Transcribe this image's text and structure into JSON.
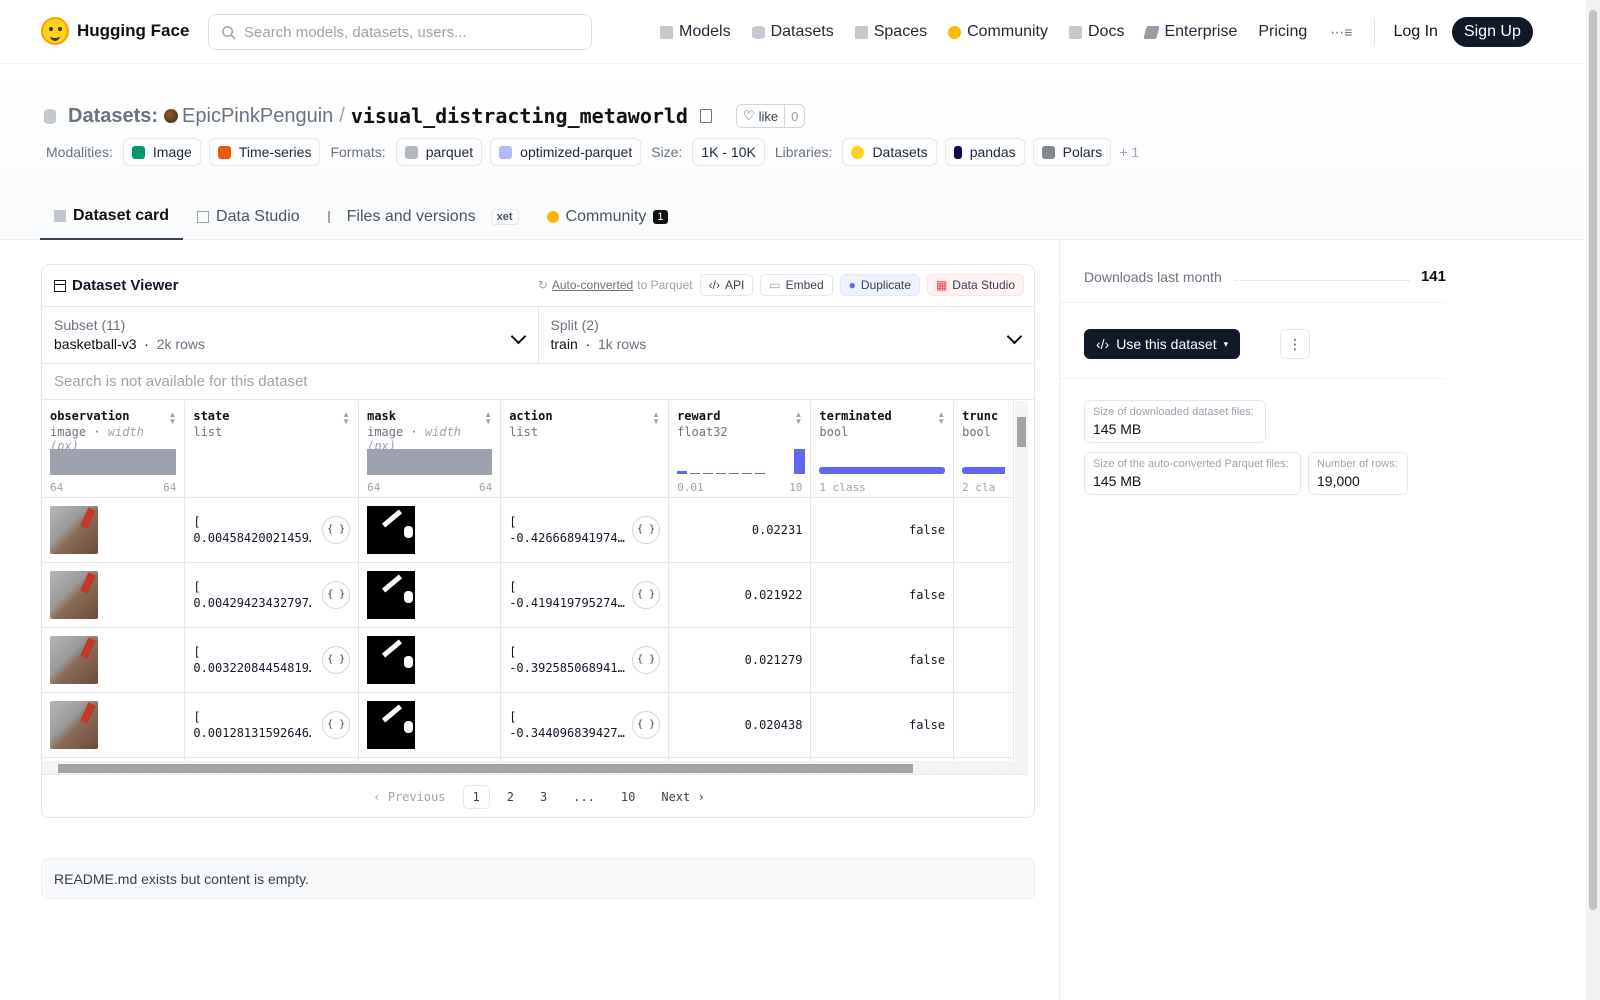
{
  "nav": {
    "brand": "Hugging Face",
    "search_placeholder": "Search models, datasets, users...",
    "links": [
      {
        "label": "Models",
        "icon": "models-icon",
        "color": "#9ca3af"
      },
      {
        "label": "Datasets",
        "icon": "datasets-icon",
        "color": "#9ca3af"
      },
      {
        "label": "Spaces",
        "icon": "spaces-icon",
        "color": "#9ca3af"
      },
      {
        "label": "Community",
        "icon": "community-icon",
        "color": "#ffb800"
      },
      {
        "label": "Docs",
        "icon": "docs-icon",
        "color": "#9ca3af"
      },
      {
        "label": "Enterprise",
        "icon": "enterprise-icon",
        "color": "#6b7280"
      },
      {
        "label": "Pricing",
        "icon": "",
        "color": ""
      }
    ],
    "login": "Log In",
    "signup": "Sign Up"
  },
  "header": {
    "section": "Datasets:",
    "owner": "EpicPinkPenguin",
    "separator": "/",
    "repo": "visual_distracting_metaworld",
    "like_label": "like",
    "like_count": "0",
    "modalities_label": "Modalities:",
    "modalities": [
      {
        "label": "Image",
        "color": "#059669"
      },
      {
        "label": "Time-series",
        "color": "#ea580c"
      }
    ],
    "formats_label": "Formats:",
    "formats": [
      {
        "label": "parquet",
        "color": "#6b7280"
      },
      {
        "label": "optimized-parquet",
        "color": "#818cf8"
      }
    ],
    "size_label": "Size:",
    "size": "1K - 10K",
    "libraries_label": "Libraries:",
    "libraries": [
      {
        "label": "Datasets",
        "color": "#ffd21e"
      },
      {
        "label": "pandas",
        "color": "#130754"
      },
      {
        "label": "Polars",
        "color": "#4b5563"
      }
    ],
    "libraries_more": "+ 1",
    "tabs": [
      {
        "label": "Dataset card"
      },
      {
        "label": "Data Studio"
      },
      {
        "label": "Files and versions",
        "badge": "xet"
      },
      {
        "label": "Community",
        "badge": "1"
      }
    ]
  },
  "viewer": {
    "title": "Dataset Viewer",
    "auto_converted": "Auto-converted",
    "to_parquet": "to Parquet",
    "buttons": {
      "api": "API",
      "embed": "Embed",
      "duplicate": "Duplicate",
      "data_studio": "Data Studio"
    },
    "subset": {
      "label": "Subset (11)",
      "value": "basketball-v3",
      "rows": "2k rows"
    },
    "split": {
      "label": "Split (2)",
      "value": "train",
      "rows": "1k rows"
    },
    "search_na": "Search is not available for this dataset",
    "columns": [
      {
        "name": "observation",
        "type": "image",
        "subtype": "width (px)",
        "range_min": "64",
        "range_max": "64"
      },
      {
        "name": "state",
        "type": "list",
        "subtype": "",
        "range_min": "",
        "range_max": ""
      },
      {
        "name": "mask",
        "type": "image",
        "subtype": "width (px)",
        "range_min": "64",
        "range_max": "64"
      },
      {
        "name": "action",
        "type": "list",
        "subtype": "",
        "range_min": "",
        "range_max": ""
      },
      {
        "name": "reward",
        "type": "float32",
        "subtype": "",
        "range_min": "0.01",
        "range_max": "10"
      },
      {
        "name": "terminated",
        "type": "bool",
        "subtype": "",
        "range_min": "1 class",
        "range_max": ""
      },
      {
        "name": "trunc",
        "type": "bool",
        "subtype": "",
        "range_min": "2 cla",
        "range_max": ""
      }
    ],
    "rows": [
      {
        "state": "[\n0.00458420021459…",
        "action": "[\n-0.426668941974…",
        "reward": "0.02231",
        "terminated": "false"
      },
      {
        "state": "[\n0.00429423432797…",
        "action": "[\n-0.419419795274…",
        "reward": "0.021922",
        "terminated": "false"
      },
      {
        "state": "[\n0.00322084454819…",
        "action": "[\n-0.392585068941…",
        "reward": "0.021279",
        "terminated": "false"
      },
      {
        "state": "[\n0.00128131592646…",
        "action": "[\n-0.344096839427…",
        "reward": "0.020438",
        "terminated": "false"
      }
    ],
    "pager": {
      "prev": "Previous",
      "pages": [
        "1",
        "2",
        "3",
        "...",
        "10"
      ],
      "next": "Next",
      "current": "1"
    }
  },
  "readme": "README.md exists but content is empty.",
  "sidebar": {
    "downloads_label": "Downloads last month",
    "downloads": "141",
    "use_button": "Use this dataset",
    "stats": [
      {
        "label": "Size of downloaded dataset files:",
        "value": "145 MB"
      },
      {
        "label": "Size of the auto-converted Parquet files:",
        "value": "145 MB"
      },
      {
        "label": "Number of rows:",
        "value": "19,000"
      }
    ]
  }
}
